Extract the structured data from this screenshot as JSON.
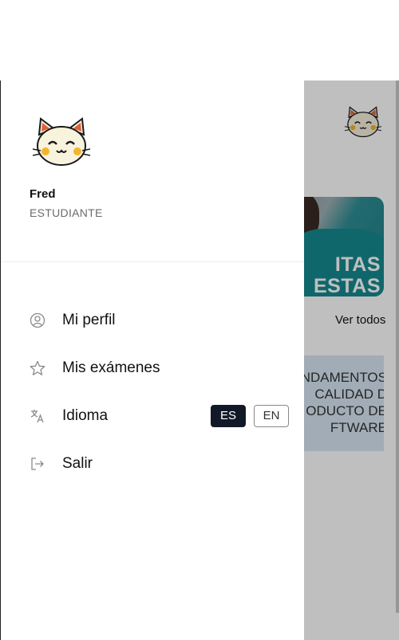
{
  "user": {
    "name": "Fred",
    "role": "ESTUDIANTE",
    "avatar_icon": "lucky-cat-avatar-icon"
  },
  "menu": {
    "items": [
      {
        "label": "Mi perfil",
        "icon": "user-circle-icon"
      },
      {
        "label": "Mis exámenes",
        "icon": "star-icon"
      },
      {
        "label": "Idioma",
        "icon": "translate-icon"
      },
      {
        "label": "Salir",
        "icon": "logout-icon"
      }
    ],
    "languages": {
      "options": [
        "ES",
        "EN"
      ],
      "selected": "ES"
    }
  },
  "background": {
    "banner_text": "ITAS\nESTAS",
    "see_all": "Ver todos",
    "course_card_text": "NDAMENTOS\nCALIDAD D\nODUCTO DE\nFTWARE"
  },
  "colors": {
    "accent_dark": "#111827",
    "overlay": "rgba(0,0,0,0.25)",
    "course_card_bg": "#d7e6f3"
  }
}
